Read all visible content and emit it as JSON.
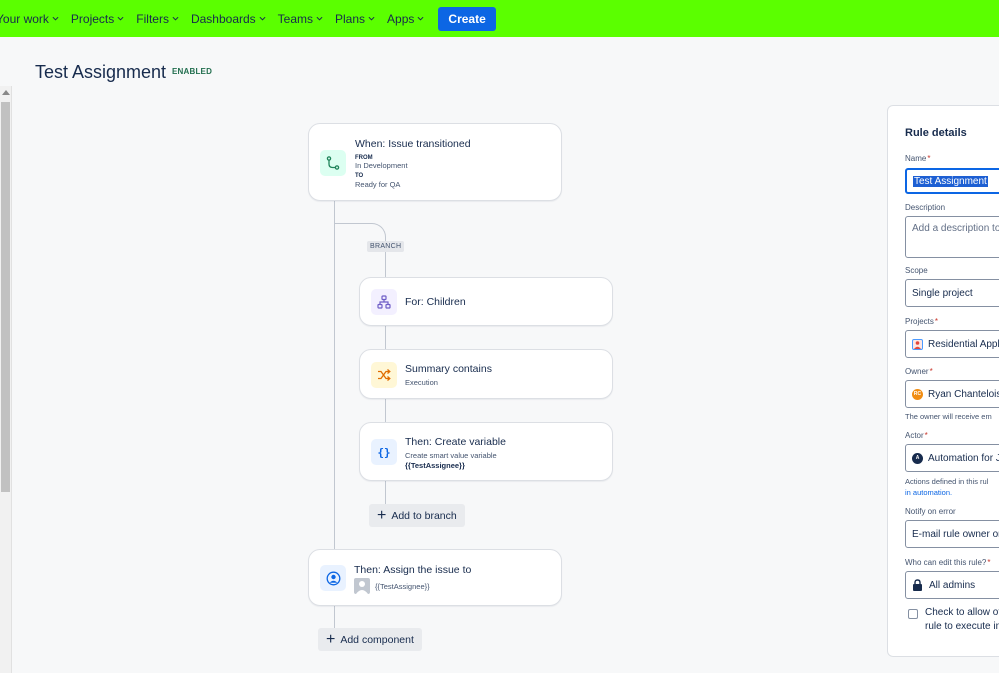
{
  "nav": {
    "items": [
      {
        "label": "Your work"
      },
      {
        "label": "Projects"
      },
      {
        "label": "Filters"
      },
      {
        "label": "Dashboards"
      },
      {
        "label": "Teams"
      },
      {
        "label": "Plans"
      },
      {
        "label": "Apps"
      }
    ],
    "create_label": "Create",
    "bar_color": "#5bff00"
  },
  "header": {
    "title": "Test Assignment",
    "status": "ENABLED"
  },
  "rule": {
    "trigger": {
      "title": "When: Issue transitioned",
      "from_label": "FROM",
      "from_value": "In Development",
      "to_label": "TO",
      "to_value": "Ready for QA",
      "icon": "transition-icon"
    },
    "branch_tag": "BRANCH",
    "branch": {
      "for": {
        "title": "For: Children",
        "icon": "hierarchy-icon"
      },
      "condition": {
        "title": "Summary contains",
        "subtitle": "Execution",
        "icon": "shuffle-icon"
      },
      "action": {
        "title": "Then: Create variable",
        "subtitle": "Create smart value variable",
        "value": "{{TestAssignee}}",
        "icon": "braces-icon"
      },
      "add_label": "Add to branch"
    },
    "assign": {
      "title": "Then: Assign the issue to",
      "value": "{{TestAssignee}}",
      "icon": "user-circle-icon"
    },
    "add_component_label": "Add component"
  },
  "panel": {
    "title": "Rule details",
    "name_label": "Name",
    "name_value": "Test Assignment",
    "description_label": "Description",
    "description_placeholder": "Add a description to",
    "scope_label": "Scope",
    "scope_value": "Single project",
    "projects_label": "Projects",
    "projects_value": "Residential Appli",
    "owner_label": "Owner",
    "owner_value": "Ryan Chantelois",
    "owner_initials": "RC",
    "owner_help": "The owner will receive em",
    "actor_label": "Actor",
    "actor_value": "Automation for J",
    "actor_help_1": "Actions defined in this rul",
    "actor_help_2": "in automation.",
    "notify_label": "Notify on error",
    "notify_value": "E-mail rule owner on",
    "edit_label": "Who can edit this rule?",
    "edit_value": "All admins",
    "check_line1": "Check to allow ot",
    "check_line2": "rule to execute in"
  }
}
